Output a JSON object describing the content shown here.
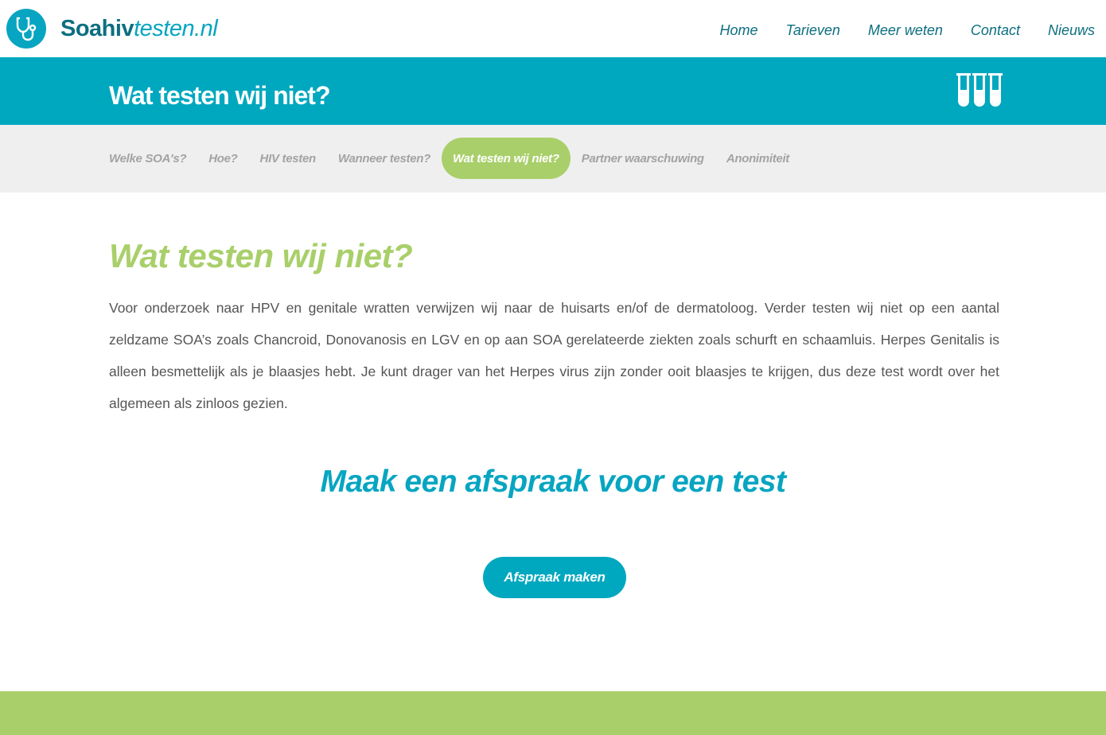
{
  "header": {
    "logo_bold": "Soahiv",
    "logo_italic": "testen.nl",
    "nav": [
      "Home",
      "Tarieven",
      "Meer weten",
      "Contact",
      "Nieuws"
    ]
  },
  "band": {
    "title": "Wat testen wij niet?",
    "icon": "test-tubes-icon"
  },
  "subnav": {
    "items": [
      "Welke SOA's?",
      "Hoe?",
      "HIV testen",
      "Wanneer testen?",
      "Wat testen wij niet?",
      "Partner waarschuwing",
      "Anonimiteit"
    ],
    "active_index": 4
  },
  "content": {
    "heading": "Wat testen wij niet?",
    "body": "Voor onderzoek naar HPV en genitale wratten verwijzen wij naar de huisarts en/of de dermatoloog. Verder testen wij niet op een aantal zeldzame SOA’s zoals Chancroid, Donovanosis en LGV en op aan SOA gerelateerde ziekten zoals schurft en schaamluis. Herpes Genitalis is alleen besmettelijk als je blaasjes hebt. Je kunt drager van het Herpes virus zijn zonder ooit blaasjes te krijgen, dus deze test wordt over het algemeen als zinloos gezien."
  },
  "cta": {
    "heading": "Maak een afspraak voor een test",
    "button_label": "Afspraak maken"
  },
  "colors": {
    "teal": "#00a8bf",
    "dark_teal": "#0d6f80",
    "green": "#a9cf6a",
    "subnav_bg": "#efefef"
  }
}
